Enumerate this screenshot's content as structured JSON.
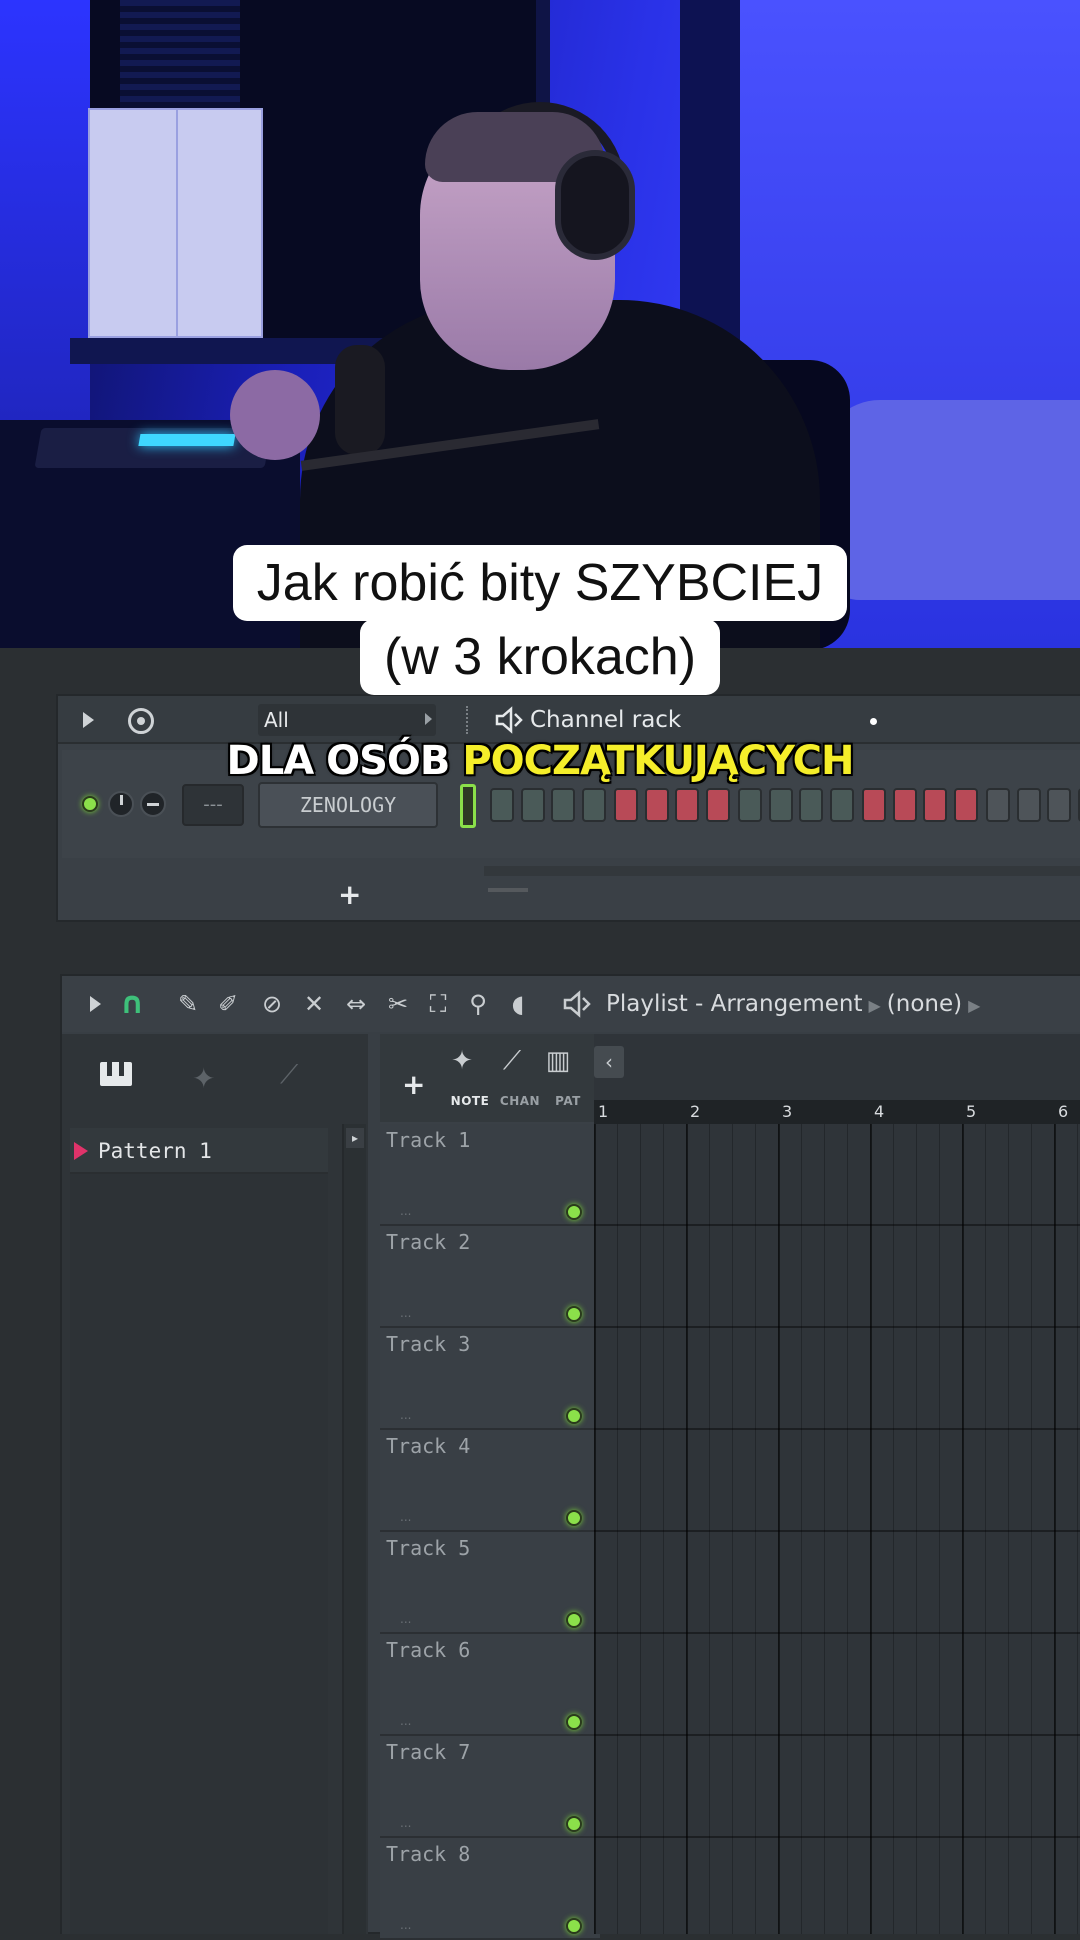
{
  "video": {
    "title_line1": "Jak robić bity SZYBCIEJ",
    "title_line2": "(w 3 krokach)",
    "subtitle_white": "DLA OSÓB",
    "subtitle_yellow": "POCZĄTKUJĄCYCH"
  },
  "channel_rack": {
    "filter_label": "All",
    "title": "Channel rack",
    "mixer_track": "---",
    "channel_name": "ZENOLOGY",
    "add_label": "+",
    "steps": [
      "dark",
      "dark",
      "dark",
      "dark",
      "red",
      "red",
      "red",
      "red",
      "dark",
      "dark",
      "dark",
      "dark",
      "red",
      "red",
      "red",
      "red",
      "grey",
      "grey",
      "grey",
      "grey"
    ]
  },
  "playlist": {
    "title": "Playlist - Arrangement",
    "pattern_selector": "(none)",
    "add_label": "+",
    "modes": [
      "NOTE",
      "CHAN",
      "PAT"
    ],
    "patterns": [
      "Pattern 1"
    ],
    "tracks": [
      "Track 1",
      "Track 2",
      "Track 3",
      "Track 4",
      "Track 5",
      "Track 6",
      "Track 7",
      "Track 8"
    ],
    "bars": [
      "1",
      "2",
      "3",
      "4",
      "5",
      "6"
    ]
  },
  "icons": {
    "play": "play-icon",
    "swing": "swing-icon",
    "magnet": "magnet-icon",
    "speaker": "speaker-icon"
  },
  "colors": {
    "accent_green": "#8be04a",
    "step_red": "#b84a57",
    "subtitle_yellow": "#f5ee2a",
    "pattern_marker": "#e0336a"
  }
}
